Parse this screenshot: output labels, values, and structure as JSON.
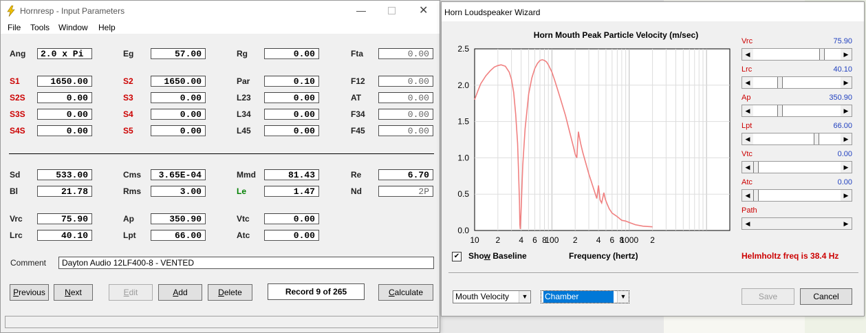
{
  "main_window": {
    "title": "Hornresp - Input Parameters",
    "menu": [
      "File",
      "Tools",
      "Window",
      "Help"
    ],
    "top_params": [
      {
        "label": "Ang",
        "value": "2.0 x Pi",
        "color": "black",
        "dim": false
      },
      {
        "label": "Eg",
        "value": "57.00",
        "color": "black",
        "dim": false
      },
      {
        "label": "Rg",
        "value": "0.00",
        "color": "black",
        "dim": false
      },
      {
        "label": "Fta",
        "value": "0.00",
        "color": "black",
        "dim": true
      },
      {
        "label": "S1",
        "value": "1650.00",
        "color": "red",
        "dim": false
      },
      {
        "label": "S2",
        "value": "1650.00",
        "color": "red",
        "dim": false
      },
      {
        "label": "Par",
        "value": "0.10",
        "color": "black",
        "dim": false
      },
      {
        "label": "F12",
        "value": "0.00",
        "color": "black",
        "dim": true
      },
      {
        "label": "S2S",
        "value": "0.00",
        "color": "red",
        "dim": false
      },
      {
        "label": "S3",
        "value": "0.00",
        "color": "red",
        "dim": false
      },
      {
        "label": "L23",
        "value": "0.00",
        "color": "black",
        "dim": false
      },
      {
        "label": "AT",
        "value": "0.00",
        "color": "black",
        "dim": true
      },
      {
        "label": "S3S",
        "value": "0.00",
        "color": "red",
        "dim": false
      },
      {
        "label": "S4",
        "value": "0.00",
        "color": "red",
        "dim": false
      },
      {
        "label": "L34",
        "value": "0.00",
        "color": "black",
        "dim": false
      },
      {
        "label": "F34",
        "value": "0.00",
        "color": "black",
        "dim": true
      },
      {
        "label": "S4S",
        "value": "0.00",
        "color": "red",
        "dim": false
      },
      {
        "label": "S5",
        "value": "0.00",
        "color": "red",
        "dim": false
      },
      {
        "label": "L45",
        "value": "0.00",
        "color": "black",
        "dim": false
      },
      {
        "label": "F45",
        "value": "0.00",
        "color": "black",
        "dim": true
      }
    ],
    "driver_params": [
      {
        "label": "Sd",
        "value": "533.00",
        "color": "black",
        "dim": false
      },
      {
        "label": "Cms",
        "value": "3.65E-04",
        "color": "black",
        "dim": false
      },
      {
        "label": "Mmd",
        "value": "81.43",
        "color": "black",
        "dim": false
      },
      {
        "label": "Re",
        "value": "6.70",
        "color": "black",
        "dim": false
      },
      {
        "label": "Bl",
        "value": "21.78",
        "color": "black",
        "dim": false
      },
      {
        "label": "Rms",
        "value": "3.00",
        "color": "black",
        "dim": false
      },
      {
        "label": "Le",
        "value": "1.47",
        "color": "green",
        "dim": false
      },
      {
        "label": "Nd",
        "value": "2P",
        "color": "black",
        "dim": true
      }
    ],
    "chamber_params": [
      {
        "label": "Vrc",
        "value": "75.90"
      },
      {
        "label": "Ap",
        "value": "350.90"
      },
      {
        "label": "Vtc",
        "value": "0.00"
      },
      {
        "label": "Lrc",
        "value": "40.10"
      },
      {
        "label": "Lpt",
        "value": "66.00"
      },
      {
        "label": "Atc",
        "value": "0.00"
      }
    ],
    "comment_label": "Comment",
    "comment_value": "Dayton Audio 12LF400-8 - VENTED",
    "buttons": {
      "previous": {
        "pre": "",
        "u": "P",
        "post": "revious"
      },
      "next": {
        "pre": "",
        "u": "N",
        "post": "ext"
      },
      "edit": {
        "pre": "",
        "u": "E",
        "post": "dit"
      },
      "add": {
        "pre": "",
        "u": "A",
        "post": "dd"
      },
      "delete": {
        "pre": "",
        "u": "D",
        "post": "elete"
      },
      "calculate": {
        "pre": "",
        "u": "C",
        "post": "alculate"
      }
    },
    "record_text": "Record 9 of 265"
  },
  "wizard": {
    "title": "Horn Loudspeaker Wizard",
    "sliders": [
      {
        "label": "Vrc",
        "value": "75.90",
        "thumb": 0.82
      },
      {
        "label": "Lrc",
        "value": "40.10",
        "thumb": 0.3
      },
      {
        "label": "Ap",
        "value": "350.90",
        "thumb": 0.3
      },
      {
        "label": "Lpt",
        "value": "66.00",
        "thumb": 0.75
      },
      {
        "label": "Vtc",
        "value": "0.00",
        "thumb": 0.0
      },
      {
        "label": "Atc",
        "value": "0.00",
        "thumb": 0.0
      },
      {
        "label": "Path",
        "value": "",
        "thumb": null
      }
    ],
    "show_baseline_label": {
      "pre": "Sho",
      "u": "w",
      "post": " Baseline"
    },
    "show_baseline_checked": "✔",
    "helmholtz_text": "Helmholtz freq is 38.4 Hz",
    "dropdown_mode": "Mouth Velocity",
    "dropdown_chamber": "Chamber",
    "save_label": "Save",
    "cancel_label": "Cancel",
    "dropdown_arrow": "▼",
    "left_arrow": "◀",
    "right_arrow": "▶"
  },
  "chart_data": {
    "type": "line",
    "title": "Horn Mouth Peak Particle Velocity (m/sec)",
    "xlabel": "Frequency (hertz)",
    "ylabel": "",
    "x_scale": "log",
    "xlim": [
      10,
      20000
    ],
    "ylim": [
      0,
      2.5
    ],
    "x_ticks": [
      {
        "v": 10,
        "label": "10"
      },
      {
        "v": 20,
        "label": "2"
      },
      {
        "v": 40,
        "label": "4"
      },
      {
        "v": 60,
        "label": "6"
      },
      {
        "v": 80,
        "label": "8"
      },
      {
        "v": 100,
        "label": "100"
      },
      {
        "v": 200,
        "label": "2"
      },
      {
        "v": 400,
        "label": "4"
      },
      {
        "v": 600,
        "label": "6"
      },
      {
        "v": 800,
        "label": "8"
      },
      {
        "v": 1000,
        "label": "1000"
      },
      {
        "v": 2000,
        "label": "2"
      }
    ],
    "y_ticks": [
      {
        "v": 0,
        "label": "0.0"
      },
      {
        "v": 0.5,
        "label": "0.5"
      },
      {
        "v": 1,
        "label": "1.0"
      },
      {
        "v": 1.5,
        "label": "1.5"
      },
      {
        "v": 2,
        "label": "2.0"
      },
      {
        "v": 2.5,
        "label": "2.5"
      }
    ],
    "grid": true,
    "line_color": "#f08080",
    "series": [
      {
        "x": [
          10,
          11,
          12,
          14,
          16,
          18,
          20,
          22,
          25,
          28,
          30,
          32,
          34,
          36,
          37,
          38,
          38.5,
          39,
          40,
          42,
          45,
          50,
          55,
          60,
          65,
          70,
          75,
          80,
          85,
          90,
          100,
          110,
          120,
          130,
          150,
          170,
          190,
          200,
          210,
          215,
          220,
          225,
          235,
          250,
          300,
          350,
          380,
          400,
          420,
          440,
          470,
          490,
          520,
          550,
          600,
          700,
          800,
          900,
          1000,
          1200,
          1500,
          2000
        ],
        "y": [
          1.8,
          1.92,
          2.02,
          2.13,
          2.2,
          2.25,
          2.27,
          2.28,
          2.26,
          2.18,
          2.08,
          1.9,
          1.6,
          1.2,
          0.8,
          0.4,
          0.08,
          0.02,
          0.3,
          0.9,
          1.4,
          1.88,
          2.1,
          2.23,
          2.3,
          2.34,
          2.35,
          2.34,
          2.32,
          2.28,
          2.18,
          2.05,
          1.92,
          1.8,
          1.58,
          1.35,
          1.15,
          1.05,
          1.0,
          1.2,
          1.36,
          1.3,
          1.2,
          1.08,
          0.78,
          0.56,
          0.44,
          0.62,
          0.42,
          0.38,
          0.52,
          0.43,
          0.36,
          0.3,
          0.24,
          0.19,
          0.14,
          0.13,
          0.11,
          0.08,
          0.06,
          0.05
        ]
      }
    ]
  }
}
